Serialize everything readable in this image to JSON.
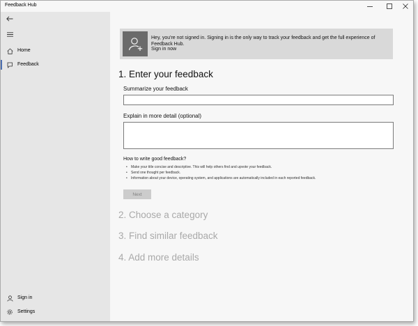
{
  "app": {
    "title": "Feedback Hub"
  },
  "window_controls": {
    "minimize": "minimize-icon",
    "maximize": "maximize-icon",
    "close": "close-icon"
  },
  "sidebar": {
    "back_icon": "back-arrow-icon",
    "menu_icon": "hamburger-menu-icon",
    "items": [
      {
        "label": "Home",
        "icon": "home-icon",
        "selected": false
      },
      {
        "label": "Feedback",
        "icon": "feedback-icon",
        "selected": true
      }
    ],
    "bottom": [
      {
        "label": "Sign in",
        "icon": "person-icon"
      },
      {
        "label": "Settings",
        "icon": "gear-icon"
      }
    ],
    "accent": "#4c6fb0"
  },
  "banner": {
    "text": "Hey, you're not signed in. Signing in is the only way to track your feedback and get the full experience of Feedback Hub.",
    "link": "Sign in now",
    "icon": "add-user-icon"
  },
  "steps": {
    "step1": "1. Enter your feedback",
    "step2": "2. Choose a category",
    "step3": "3. Find similar feedback",
    "step4": "4. Add more details"
  },
  "form": {
    "summary_label": "Summarize your feedback",
    "summary_value": "",
    "detail_label": "Explain in more detail (optional)",
    "detail_value": ""
  },
  "tips": {
    "title": "How to write good feedback?",
    "items": [
      "Make your title concise and descriptive. This will help others find and upvote your feedback.",
      "Send one thought per feedback.",
      "Information about your device, operating system, and applications are automatically included in each reported feedback."
    ]
  },
  "next_button": "Next"
}
